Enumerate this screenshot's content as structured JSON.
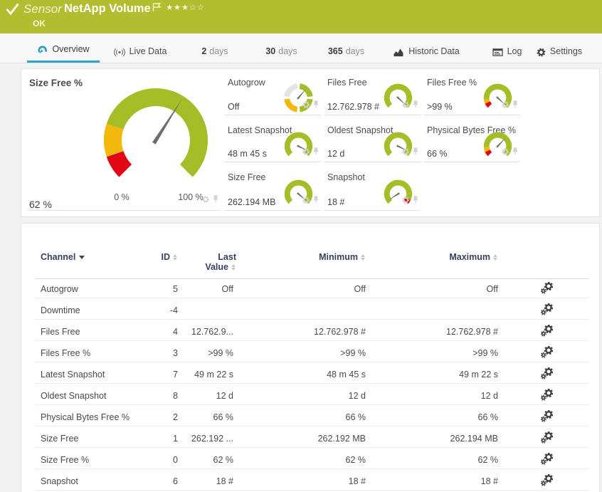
{
  "colors": {
    "header_green": "#b2bd2f",
    "accent_blue": "#2ba3cf",
    "gauge_green": "#a5be28",
    "gauge_yellow": "#f2b80c",
    "gauge_red": "#e00613",
    "gauge_gray": "#e4e4e4",
    "needle_gray": "#6d6d6d"
  },
  "header": {
    "kind": "Sensor",
    "title": "NetApp Volume",
    "status": "OK",
    "priority_stars": 3,
    "priority_stars_total": 5,
    "icons": [
      "check-icon",
      "flag-icon",
      "star-icons"
    ]
  },
  "tabs": [
    {
      "id": "overview",
      "label": "Overview",
      "icon": "gauge-icon",
      "active": true
    },
    {
      "id": "live-data",
      "label": "Live Data",
      "icon": "broadcast-icon",
      "active": false
    },
    {
      "id": "2-days",
      "number": "2",
      "label": "days",
      "active": false
    },
    {
      "id": "30-days",
      "number": "30",
      "label": "days",
      "active": false
    },
    {
      "id": "365-days",
      "number": "365",
      "label": "days",
      "active": false
    },
    {
      "id": "historic-data",
      "label": "Historic Data",
      "icon": "area-chart-icon",
      "active": false
    },
    {
      "id": "log",
      "label": "Log",
      "icon": "console-icon",
      "active": false
    },
    {
      "id": "settings",
      "label": "Settings",
      "icon": "gear-icon",
      "active": false
    }
  ],
  "chart_data": [
    {
      "type": "gauge",
      "title": "Size Free %",
      "value": "62 %",
      "value_fraction": 0.62,
      "min_label": "0 %",
      "max_label": "100 %",
      "sweep_degrees": 270,
      "segments": [
        {
          "color": "red",
          "from": 0,
          "to": 0.098
        },
        {
          "color": "yellow",
          "from": 0.098,
          "to": 0.235
        },
        {
          "color": "green",
          "from": 0.235,
          "to": 1
        }
      ]
    },
    {
      "type": "gauge-circle",
      "title": "Autogrow",
      "value": "Off",
      "needle_bearing": 40,
      "segments": [
        {
          "color": "green",
          "from": 0,
          "to": 0.25
        },
        {
          "color": "green",
          "from": 0.25,
          "to": 0.5
        },
        {
          "color": "yellow",
          "from": 0.5,
          "to": 0.75
        },
        {
          "color": "gray",
          "from": 0.75,
          "to": 1
        }
      ]
    },
    {
      "type": "gauge",
      "title": "Files Free",
      "value": "12.762.978 #",
      "value_fraction": 0.995,
      "sweep_degrees": 270,
      "segments": [
        {
          "color": "green",
          "from": 0,
          "to": 1
        }
      ]
    },
    {
      "type": "gauge",
      "title": "Files Free %",
      "value": ">99 %",
      "value_fraction": 0.995,
      "sweep_degrees": 270,
      "segments": [
        {
          "color": "red",
          "from": 0,
          "to": 0.075
        },
        {
          "color": "yellow",
          "from": 0.075,
          "to": 0.145
        },
        {
          "color": "green",
          "from": 0.145,
          "to": 1
        }
      ]
    },
    {
      "type": "gauge",
      "title": "Latest Snapshot",
      "value": "48 m 45 s",
      "value_fraction": 0.93,
      "sweep_degrees": 270,
      "segments": [
        {
          "color": "green",
          "from": 0,
          "to": 1
        }
      ]
    },
    {
      "type": "gauge",
      "title": "Oldest Snapshot",
      "value": "12 d",
      "value_fraction": 0.93,
      "sweep_degrees": 270,
      "segments": [
        {
          "color": "green",
          "from": 0,
          "to": 1
        }
      ]
    },
    {
      "type": "gauge",
      "title": "Physical Bytes Free %",
      "value": "66 %",
      "value_fraction": 0.66,
      "sweep_degrees": 270,
      "segments": [
        {
          "color": "red",
          "from": 0,
          "to": 0.075
        },
        {
          "color": "yellow",
          "from": 0.075,
          "to": 0.15
        },
        {
          "color": "green",
          "from": 0.15,
          "to": 1
        }
      ]
    },
    {
      "type": "gauge",
      "title": "Size Free",
      "value": "262.194 MB",
      "value_fraction": 0.985,
      "sweep_degrees": 270,
      "segments": [
        {
          "color": "green",
          "from": 0,
          "to": 1
        }
      ]
    },
    {
      "type": "gauge",
      "title": "Snapshot",
      "value": "18 #",
      "value_fraction": 0.046,
      "sweep_degrees": 270,
      "segments": [
        {
          "color": "green",
          "from": 0,
          "to": 0.93
        },
        {
          "color": "red",
          "from": 0.93,
          "to": 1
        }
      ]
    }
  ],
  "table": {
    "columns": [
      {
        "key": "channel",
        "label": "Channel",
        "sort": "desc"
      },
      {
        "key": "id",
        "label": "ID",
        "sort": "none"
      },
      {
        "key": "last",
        "label": "Last Value",
        "label_line1": "Last",
        "label_line2": "Value",
        "sort": "none"
      },
      {
        "key": "min",
        "label": "Minimum",
        "sort": "none"
      },
      {
        "key": "max",
        "label": "Maximum",
        "sort": "none"
      }
    ],
    "row_action_icon": "gears-icon",
    "rows": [
      {
        "channel": "Autogrow",
        "id": "5",
        "last": "Off",
        "min": "Off",
        "max": "Off"
      },
      {
        "channel": "Downtime",
        "id": "-4",
        "last": "",
        "min": "",
        "max": ""
      },
      {
        "channel": "Files Free",
        "id": "4",
        "last": "12.762.9...",
        "min": "12.762.978 #",
        "max": "12.762.978 #"
      },
      {
        "channel": "Files Free %",
        "id": "3",
        "last": ">99 %",
        "min": ">99 %",
        "max": ">99 %"
      },
      {
        "channel": "Latest Snapshot",
        "id": "7",
        "last": "49 m 22 s",
        "min": "48 m 45 s",
        "max": "49 m 22 s"
      },
      {
        "channel": "Oldest Snapshot",
        "id": "8",
        "last": "12 d",
        "min": "12 d",
        "max": "12 d"
      },
      {
        "channel": "Physical Bytes Free %",
        "id": "2",
        "last": "66 %",
        "min": "66 %",
        "max": "66 %"
      },
      {
        "channel": "Size Free",
        "id": "1",
        "last": "262.192 ...",
        "min": "262.192 MB",
        "max": "262.194 MB"
      },
      {
        "channel": "Size Free %",
        "id": "0",
        "last": "62 %",
        "min": "62 %",
        "max": "62 %"
      },
      {
        "channel": "Snapshot",
        "id": "6",
        "last": "18 #",
        "min": "18 #",
        "max": "18 #"
      }
    ]
  },
  "cell_action_icons": [
    "gear-icon",
    "pin-icon"
  ]
}
